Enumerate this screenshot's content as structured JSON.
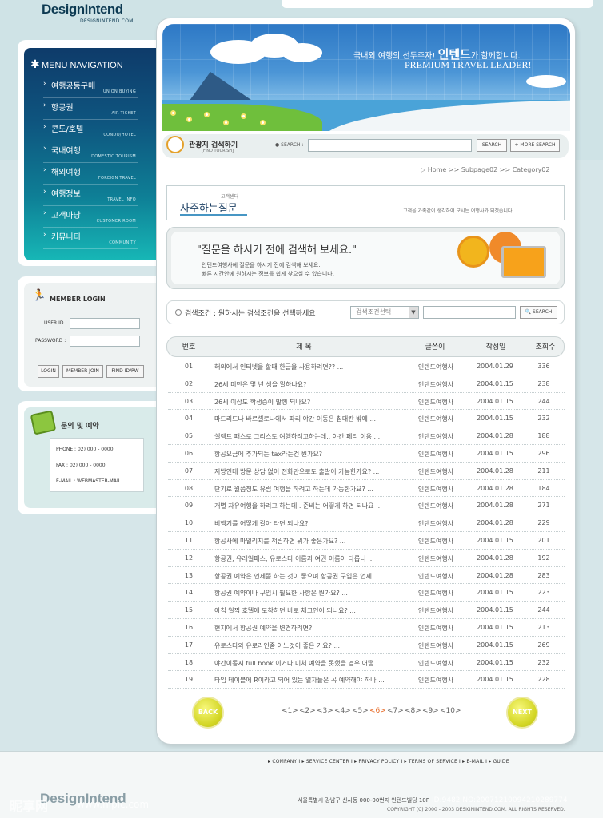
{
  "logo": {
    "name": "DesignIntend",
    "url": "DESIGNINTEND.COM"
  },
  "menu": {
    "title": "MENU NAVIGATION",
    "items": [
      {
        "ko": "여행공동구매",
        "en": "UNION BUYING"
      },
      {
        "ko": "항공권",
        "en": "AIR TICKET"
      },
      {
        "ko": "콘도/호텔",
        "en": "CONDO/HOTEL"
      },
      {
        "ko": "국내여행",
        "en": "DOMESTIC TOURISM"
      },
      {
        "ko": "해외여행",
        "en": "FOREIGN TRAVEL"
      },
      {
        "ko": "여행정보",
        "en": "TRAVEL INFO"
      },
      {
        "ko": "고객마당",
        "en": "CUSTOMER ROOM"
      },
      {
        "ko": "커뮤니티",
        "en": "COMMUNITY"
      }
    ]
  },
  "login": {
    "title": "MEMBER LOGIN",
    "userid_label": "USER ID :",
    "password_label": "PASSWORD :",
    "login_btn": "LOGIN",
    "join_btn": "MEMBER JOIN",
    "find_btn": "FIND ID/PW"
  },
  "contact": {
    "title": "문의 및 예약",
    "phone": "PHONE : 02) 000 - 0000",
    "fax": "FAX : 02) 000 - 0000",
    "email": "E-MAIL : WEBMASTER-MAIL"
  },
  "banner": {
    "ko_prefix": "국내외 여행의 선두주자!",
    "ko_brand": "인텐드",
    "ko_suffix": "가 함께합니다.",
    "en": "PREMIUM TRAVEL LEADER!"
  },
  "search": {
    "title": "관광지 검색하기",
    "subtitle": "[FIND TOURISH]",
    "label": "● SEARCH :",
    "button": "SEARCH",
    "more_button": "+ MORE SEARCH"
  },
  "breadcrumb": "▷ Home  >>  Subpage02  >>  Category02",
  "page": {
    "category": "고객센터",
    "title": "자주하는질문",
    "description": "고객을 가족같이 생각하여 모시는 여행사가 되겠습니다."
  },
  "notice": {
    "title": "\"질문을 하시기 전에 검색해 보세요.\"",
    "line1": "인텐드여행사에 질문을 하시기 전에 검색해 보세요.",
    "line2": "빠른 시간안에 원하시는 정보를 쉽게 찾으실 수 있습니다."
  },
  "filter": {
    "label": "검색조건 : 원하시는 검색조건을 선택하세요",
    "select_value": "검색조건선택",
    "button": "SEARCH"
  },
  "table": {
    "headers": [
      "번호",
      "제 목",
      "글쓴이",
      "작성일",
      "조회수"
    ],
    "rows": [
      [
        "01",
        "해외에서 인터넷을 할때 한글을 사용하려면?? ...",
        "인텐드여행사",
        "2004.01.29",
        "336"
      ],
      [
        "02",
        "26세 미만은 몇 년 생을 말하나요?",
        "인텐드여행사",
        "2004.01.15",
        "238"
      ],
      [
        "03",
        "26세 이상도 학생증이 발행 되나요?",
        "인텐드여행사",
        "2004.01.15",
        "244"
      ],
      [
        "04",
        "마드리드나 바르셀로나에서 파리 야간 이동은 침대칸 밖에 ...",
        "인텐드여행사",
        "2004.01.15",
        "232"
      ],
      [
        "05",
        "셀렉트 패스로 그리스도 여행하려고하는데.. 야간 페리 이용 ...",
        "인텐드여행사",
        "2004.01.28",
        "188"
      ],
      [
        "06",
        "항공요금에 추가되는 tax라는건 뭔가요?",
        "인텐드여행사",
        "2004.01.15",
        "296"
      ],
      [
        "07",
        "지방인데 방문 상담 없이 전화만으로도 출발이 가능한가요? ...",
        "인텐드여행사",
        "2004.01.28",
        "211"
      ],
      [
        "08",
        "단기로 월쯤정도 유럽 여행을 하려고 하는데 가능한가요? ...",
        "인텐드여행사",
        "2004.01.28",
        "184"
      ],
      [
        "09",
        "개별 자유여행을 하려고 하는데.. 준비는 어떻게 하면 되나요 ...",
        "인텐드여행사",
        "2004.01.28",
        "271"
      ],
      [
        "10",
        "비행기를 어떻게 갈아 타면 되나요?",
        "인텐드여행사",
        "2004.01.28",
        "229"
      ],
      [
        "11",
        "항공사에 마일리지를 적립하면 뭐가 좋은가요? ...",
        "인텐드여행사",
        "2004.01.15",
        "201"
      ],
      [
        "12",
        "항공권, 유레일패스, 유로스타 이름과 여권 이름이 다릅니 ...",
        "인텐드여행사",
        "2004.01.28",
        "192"
      ],
      [
        "13",
        "항공권 예약은 언제쯤 하는 것이 좋으며 항공권 구입은 언제 ...",
        "인텐드여행사",
        "2004.01.28",
        "283"
      ],
      [
        "14",
        "항공권 예약이나 구입시 필요한 사항은 뭔가요? ...",
        "인텐드여행사",
        "2004.01.15",
        "223"
      ],
      [
        "15",
        "아침 일찍 호텔에 도착하면 바로 체크인이 되나요? ...",
        "인텐드여행사",
        "2004.01.15",
        "244"
      ],
      [
        "16",
        "현지에서 항공권 예약을 변경하려면?",
        "인텐드여행사",
        "2004.01.15",
        "213"
      ],
      [
        "17",
        "유로스타와 유로라인중 어느것이 좋은 가요? ...",
        "인텐드여행사",
        "2004.01.15",
        "269"
      ],
      [
        "18",
        "야간이동시 full book 이거나 미처 예약을 못했을 경우 어떻 ...",
        "인텐드여행사",
        "2004.01.15",
        "232"
      ],
      [
        "19",
        "타임 테이블에 R이라고 되어 있는 열차들은 꼭 예약해야 하나 ...",
        "인텐드여행사",
        "2004.01.15",
        "228"
      ]
    ]
  },
  "pager": {
    "back": "BACK",
    "next": "NEXT",
    "pages": [
      "<1>",
      "<2>",
      "<3>",
      "<4>",
      "<5>",
      "<6>",
      "<7>",
      "<8>",
      "<9>",
      "<10>"
    ],
    "active_index": 5
  },
  "footer": {
    "links": "▸ COMPANY  I  ▸ SERVICE CENTER  I  ▸ PRIVACY POLICY  I  ▸ TERMS OF SERVICE  I  ▸ E-MAIL  I  ▸ GUIDE",
    "address": "서울특별시 강남구 신사동 000-00번지 인텐드빌딩 10F",
    "copyright": "COPYRIGHT (C) 2000 - 2003 DESIGNINTEND.COM. ALL RIGHTS RESERVED.",
    "watermark": "昵享网",
    "watermark_url": "www.nipic.com",
    "watermark_id": "ID:9482 NO:20071210094210289774"
  },
  "colors": {
    "menu_top": "#0e3b6a",
    "menu_bottom": "#17b7b6",
    "active_page": "#e5621b",
    "pager_button": "#d3d625"
  }
}
